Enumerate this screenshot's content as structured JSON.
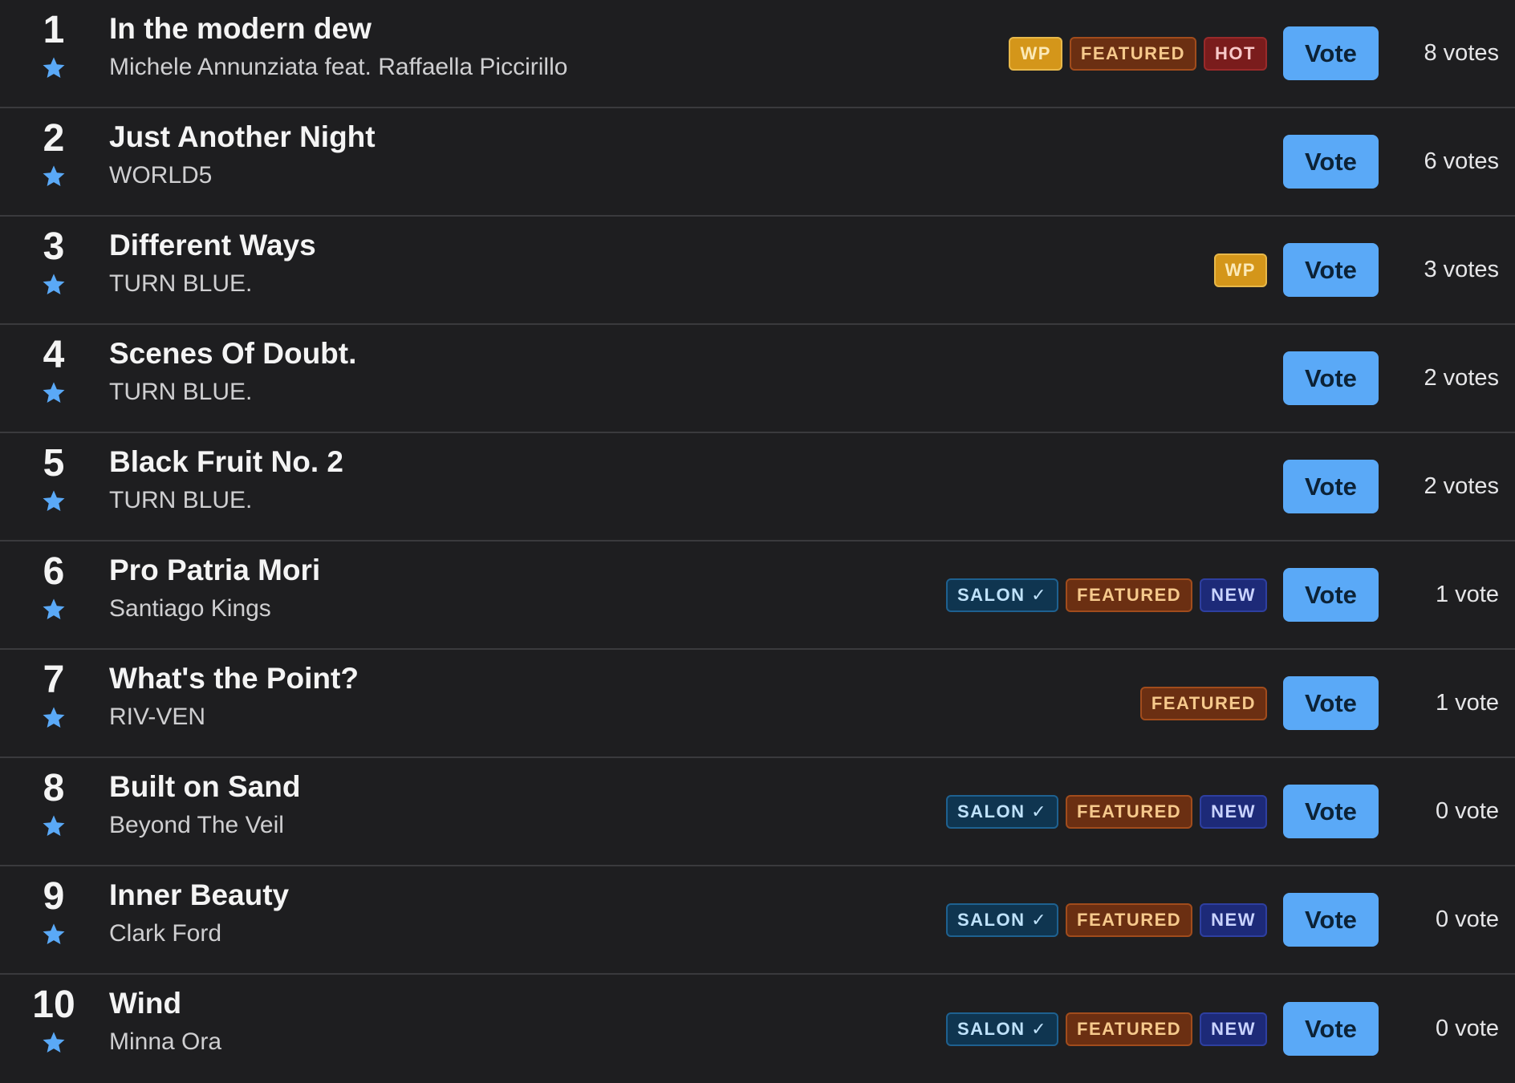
{
  "colors": {
    "background": "#1e1e20",
    "accent": "#5aa9f7",
    "star": "#5aa9f7"
  },
  "tracks": [
    {
      "rank": "1",
      "title": "In the modern dew",
      "artist": "Michele Annunziata feat. Raffaella Piccirillo",
      "badges": [
        {
          "type": "wp",
          "label": "WP"
        },
        {
          "type": "featured",
          "label": "FEATURED"
        },
        {
          "type": "hot",
          "label": "HOT"
        }
      ],
      "vote_label": "Vote",
      "votes": "8 votes"
    },
    {
      "rank": "2",
      "title": "Just Another Night",
      "artist": "WORLD5",
      "badges": [],
      "vote_label": "Vote",
      "votes": "6 votes"
    },
    {
      "rank": "3",
      "title": "Different Ways",
      "artist": "TURN BLUE.",
      "badges": [
        {
          "type": "wp",
          "label": "WP"
        }
      ],
      "vote_label": "Vote",
      "votes": "3 votes"
    },
    {
      "rank": "4",
      "title": "Scenes Of Doubt.",
      "artist": "TURN BLUE.",
      "badges": [],
      "vote_label": "Vote",
      "votes": "2 votes"
    },
    {
      "rank": "5",
      "title": "Black Fruit No. 2",
      "artist": "TURN BLUE.",
      "badges": [],
      "vote_label": "Vote",
      "votes": "2 votes"
    },
    {
      "rank": "6",
      "title": "Pro Patria Mori",
      "artist": "Santiago Kings",
      "badges": [
        {
          "type": "salon",
          "label": "SALON ✓"
        },
        {
          "type": "featured",
          "label": "FEATURED"
        },
        {
          "type": "new",
          "label": "NEW"
        }
      ],
      "vote_label": "Vote",
      "votes": "1 vote"
    },
    {
      "rank": "7",
      "title": "What's the Point?",
      "artist": "RIV-VEN",
      "badges": [
        {
          "type": "featured",
          "label": "FEATURED"
        }
      ],
      "vote_label": "Vote",
      "votes": "1 vote"
    },
    {
      "rank": "8",
      "title": "Built on Sand",
      "artist": "Beyond The Veil",
      "badges": [
        {
          "type": "salon",
          "label": "SALON ✓"
        },
        {
          "type": "featured",
          "label": "FEATURED"
        },
        {
          "type": "new",
          "label": "NEW"
        }
      ],
      "vote_label": "Vote",
      "votes": "0 vote"
    },
    {
      "rank": "9",
      "title": "Inner Beauty",
      "artist": "Clark Ford",
      "badges": [
        {
          "type": "salon",
          "label": "SALON ✓"
        },
        {
          "type": "featured",
          "label": "FEATURED"
        },
        {
          "type": "new",
          "label": "NEW"
        }
      ],
      "vote_label": "Vote",
      "votes": "0 vote"
    },
    {
      "rank": "10",
      "title": "Wind",
      "artist": "Minna Ora",
      "badges": [
        {
          "type": "salon",
          "label": "SALON ✓"
        },
        {
          "type": "featured",
          "label": "FEATURED"
        },
        {
          "type": "new",
          "label": "NEW"
        }
      ],
      "vote_label": "Vote",
      "votes": "0 vote"
    }
  ]
}
